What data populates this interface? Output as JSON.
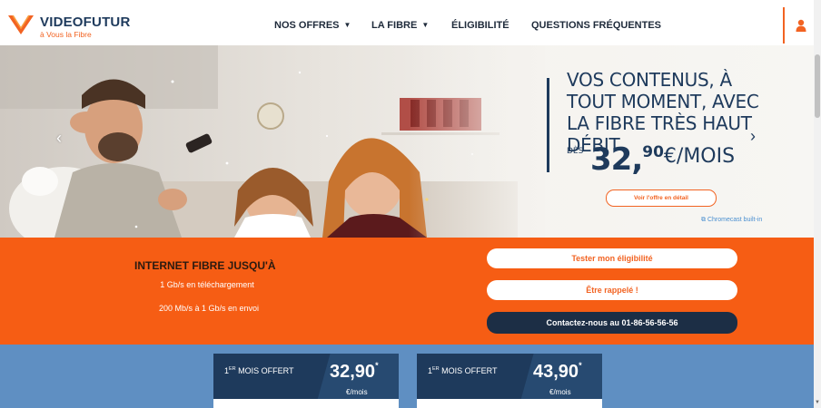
{
  "header": {
    "logo": {
      "name": "VIDEOFUTUR",
      "tagline": "à Vous la Fibre",
      "icon": "videofutur-v-logo"
    },
    "nav": [
      {
        "label": "NOS OFFRES",
        "dropdown": true
      },
      {
        "label": "LA FIBRE",
        "dropdown": true
      },
      {
        "label": "ÉLIGIBILITÉ",
        "dropdown": false
      },
      {
        "label": "QUESTIONS FRÉQUENTES",
        "dropdown": false
      }
    ],
    "caret": "▼",
    "user_icon": "user-icon"
  },
  "hero": {
    "title": "VOS CONTENUS, À TOUT MOMENT, AVEC LA FIBRE TRÈS HAUT DÉBIT",
    "from_label": "DÈS",
    "price_main": "32,",
    "price_cents": "90",
    "price_unit": "€/MOIS",
    "cta": "Voir l'offre en détail",
    "chromecast": "Chromecast built-in",
    "arrow_left": "‹",
    "arrow_right": "›"
  },
  "band": {
    "title": "INTERNET FIBRE JUSQU'À",
    "line1": "1 Gb/s en téléchargement",
    "line2": "200 Mb/s à 1 Gb/s en envoi",
    "buttons": {
      "test": "Tester mon éligibilité",
      "callback": "Être rappelé !",
      "contact": "Contactez-nous au 01-86-56-56-56"
    }
  },
  "offers": [
    {
      "label_num": "1",
      "label_sup": "ER",
      "label_text": "MOIS OFFERT",
      "price": "32,90",
      "asterisk": "*",
      "unit": "€/mois"
    },
    {
      "label_num": "1",
      "label_sup": "ER",
      "label_text": "MOIS OFFERT",
      "price": "43,90",
      "asterisk": "*",
      "unit": "€/mois"
    }
  ],
  "colors": {
    "brand_orange": "#f26322",
    "band_orange": "#f65d14",
    "navy": "#1e3a5c",
    "offers_blue": "#5f8fc2"
  }
}
